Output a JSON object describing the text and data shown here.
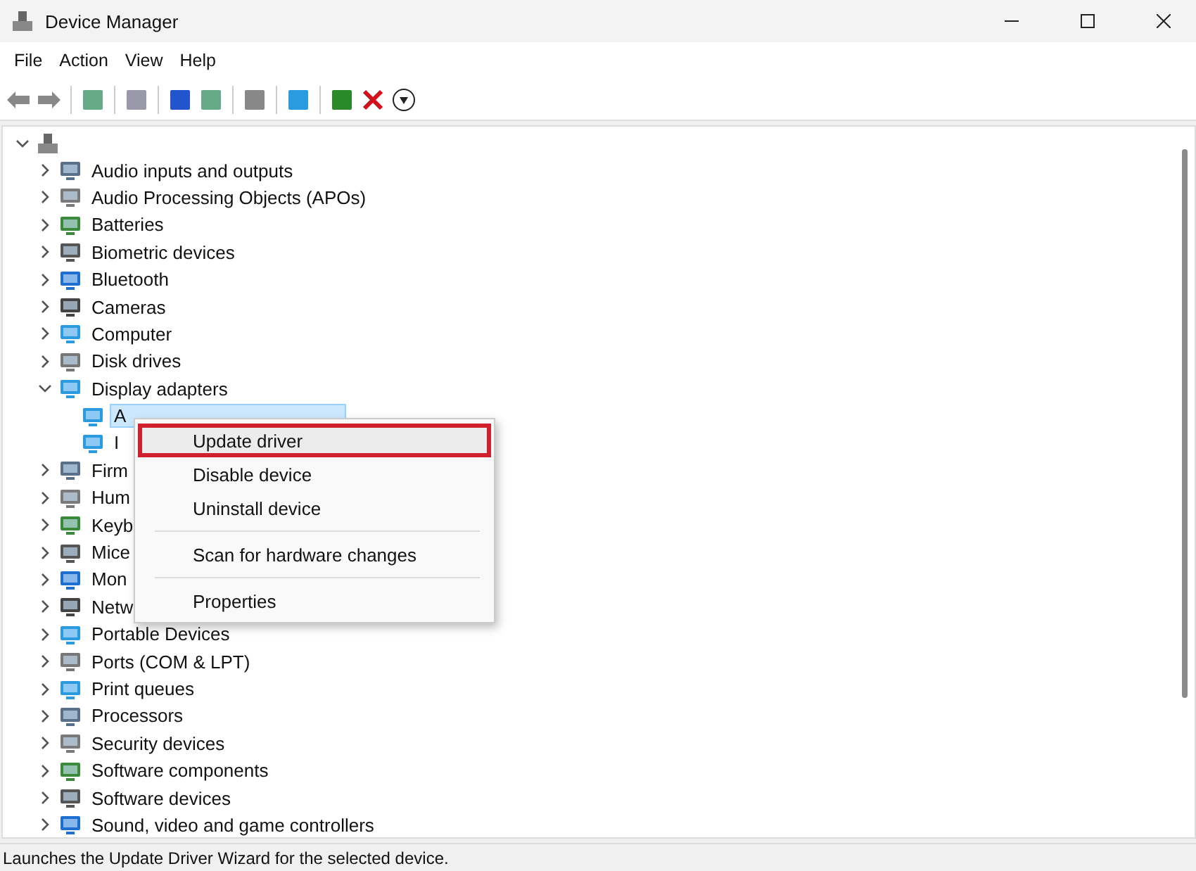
{
  "window": {
    "title": "Device Manager"
  },
  "menu_bar": [
    "File",
    "Action",
    "View",
    "Help"
  ],
  "tree": {
    "expanded": true,
    "children": [
      {
        "label": "Audio inputs and outputs",
        "expanded": false,
        "selected": false
      },
      {
        "label": "Audio Processing Objects (APOs)",
        "expanded": false,
        "selected": false
      },
      {
        "label": "Batteries",
        "expanded": false,
        "selected": false
      },
      {
        "label": "Biometric devices",
        "expanded": false,
        "selected": false
      },
      {
        "label": "Bluetooth",
        "expanded": false,
        "selected": false
      },
      {
        "label": "Cameras",
        "expanded": false,
        "selected": false
      },
      {
        "label": "Computer",
        "expanded": false,
        "selected": false
      },
      {
        "label": "Disk drives",
        "expanded": false,
        "selected": false
      },
      {
        "label": "Display adapters",
        "expanded": true,
        "selected": false,
        "children": [
          {
            "label": "A",
            "selected": true
          },
          {
            "label": "I",
            "selected": false
          }
        ]
      },
      {
        "label": "Firm",
        "expanded": false,
        "selected": false
      },
      {
        "label": "Hum",
        "expanded": false,
        "selected": false
      },
      {
        "label": "Keyb",
        "expanded": false,
        "selected": false
      },
      {
        "label": "Mice",
        "expanded": false,
        "selected": false
      },
      {
        "label": "Mon",
        "expanded": false,
        "selected": false
      },
      {
        "label": "Netw",
        "expanded": false,
        "selected": false
      },
      {
        "label": "Portable Devices",
        "expanded": false,
        "selected": false
      },
      {
        "label": "Ports (COM & LPT)",
        "expanded": false,
        "selected": false
      },
      {
        "label": "Print queues",
        "expanded": false,
        "selected": false
      },
      {
        "label": "Processors",
        "expanded": false,
        "selected": false
      },
      {
        "label": "Security devices",
        "expanded": false,
        "selected": false
      },
      {
        "label": "Software components",
        "expanded": false,
        "selected": false
      },
      {
        "label": "Software devices",
        "expanded": false,
        "selected": false
      },
      {
        "label": "Sound, video and game controllers",
        "expanded": false,
        "selected": false
      }
    ]
  },
  "context_menu": [
    {
      "kind": "item",
      "label": "Update driver",
      "selected": true
    },
    {
      "kind": "item",
      "label": "Disable device",
      "selected": false
    },
    {
      "kind": "item",
      "label": "Uninstall device",
      "selected": false
    },
    {
      "kind": "separator"
    },
    {
      "kind": "item",
      "label": "Scan for hardware changes",
      "selected": false
    },
    {
      "kind": "separator"
    },
    {
      "kind": "item",
      "label": "Properties",
      "selected": false
    }
  ],
  "status_bar": "Launches the Update Driver Wizard for the selected device."
}
